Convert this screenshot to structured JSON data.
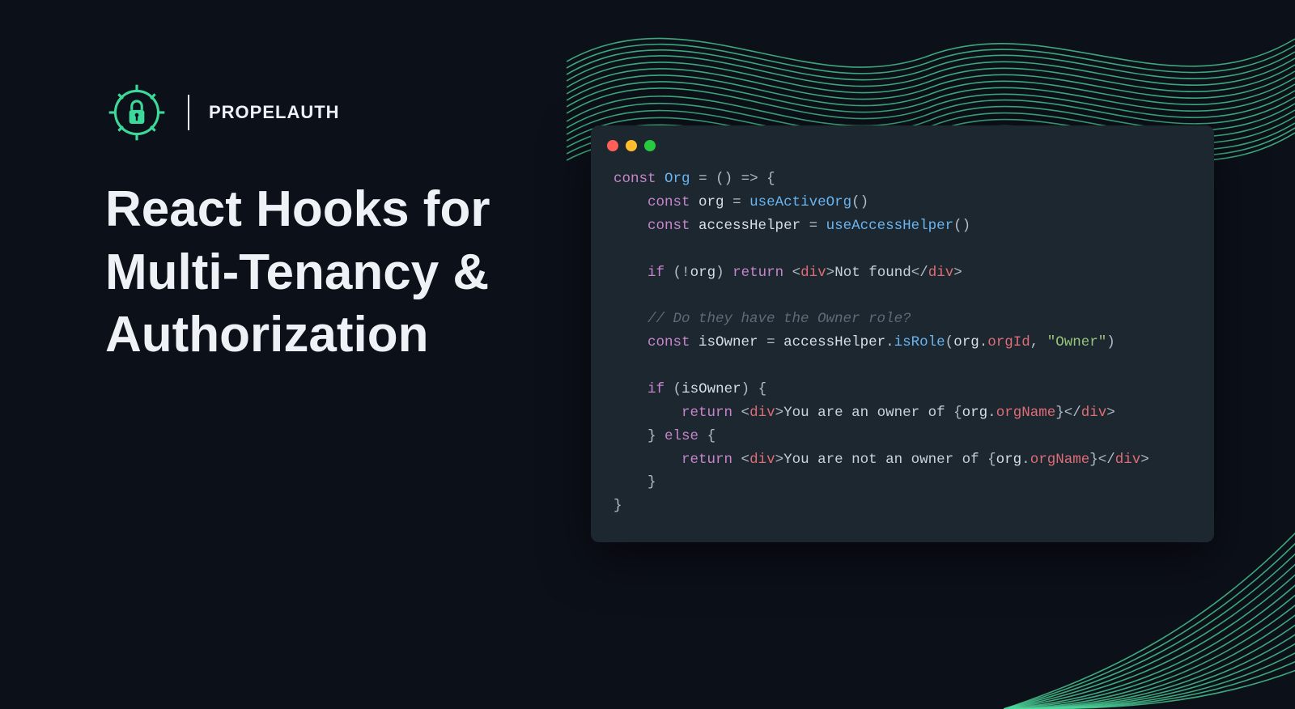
{
  "brand": "PROPELAUTH",
  "headline": "React Hooks for\nMulti-Tenancy &\nAuthorization",
  "code": {
    "line1_org": "Org",
    "line2_org": "org",
    "line2_hook": "useActiveOrg",
    "line3_var": "accessHelper",
    "line3_hook": "useAccessHelper",
    "line5_org": "org",
    "line5_notfound": "Not found",
    "line7_comment": "// Do they have the Owner role?",
    "line8_var": "isOwner",
    "line8_helper": "accessHelper",
    "line8_method": "isRole",
    "line8_arg1a": "org",
    "line8_arg1b": "orgId",
    "line8_arg2": "\"Owner\"",
    "line10_cond": "isOwner",
    "line11_text": "You are an owner of ",
    "line11_obj": "org",
    "line11_prop": "orgName",
    "line13_text": "You are not an owner of ",
    "line13_obj": "org",
    "line13_prop": "orgName"
  }
}
